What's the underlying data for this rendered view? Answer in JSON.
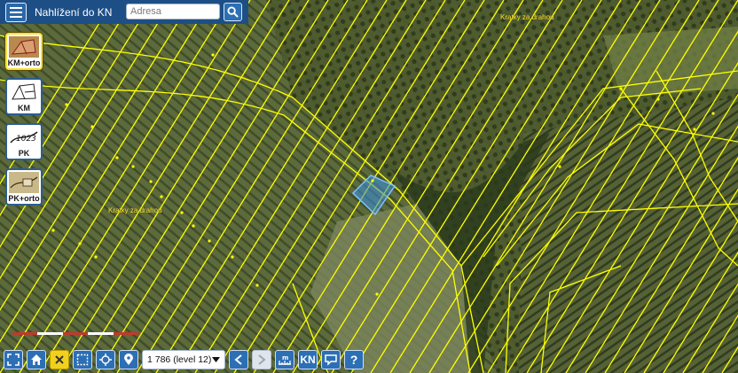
{
  "app": {
    "title": "Nahlížení do KN"
  },
  "search": {
    "placeholder": "Adresa"
  },
  "layers": [
    {
      "label": "KM+orto",
      "icon": "cadastral-map-with-ortho-icon",
      "active": true
    },
    {
      "label": "KM",
      "icon": "cadastral-map-icon",
      "active": false
    },
    {
      "label": "PK",
      "icon": "land-register-map-icon",
      "active": false
    },
    {
      "label": "PK+orto",
      "icon": "land-register-with-ortho-icon",
      "active": false
    }
  ],
  "map": {
    "place_labels": [
      "Kratky za drahou",
      "Kratky za drahou"
    ],
    "parcel_line_color": "#ffff00",
    "selection_color": "#3a8fe0"
  },
  "toolbar": {
    "scale_value": "1 786 (level 12)",
    "kn_label": "KN",
    "help_label": "?",
    "buttons": [
      "fullscreen-icon",
      "home-icon",
      "clear-icon",
      "select-area-icon",
      "locate-icon",
      "marker-icon",
      "prev-icon",
      "next-icon",
      "measure-icon",
      "kn-icon",
      "info-icon",
      "help-icon"
    ]
  },
  "colors": {
    "header": "#1d4f86",
    "button": "#2c6fb5",
    "accent_yellow": "#f2d01e"
  }
}
